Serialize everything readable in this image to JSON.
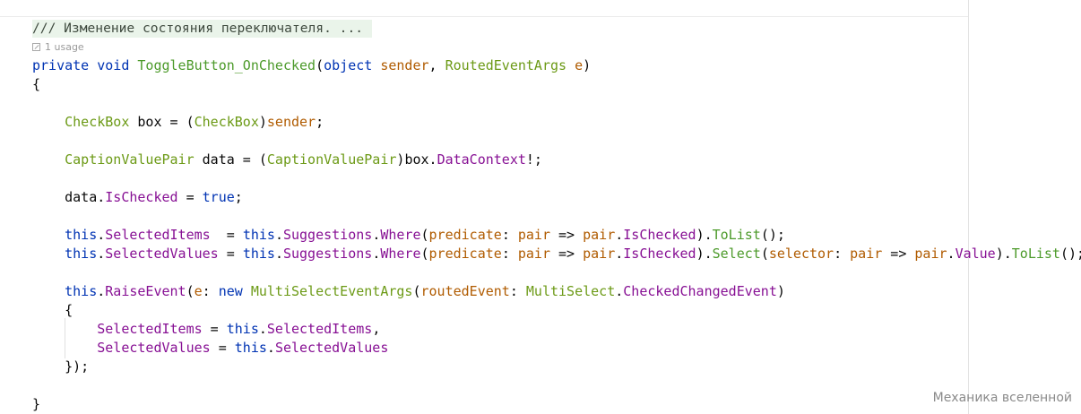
{
  "doc_comment": "/// Изменение состояния переключателя. ...",
  "usage_hint": "1 usage",
  "code": {
    "l1": {
      "kw_private": "private",
      "kw_void": "void",
      "method": "ToggleButton_OnChecked",
      "paren_open": "(",
      "kw_object": "object",
      "p_sender": "sender",
      "comma": ", ",
      "t_args": "RoutedEventArgs",
      "p_e": "e",
      "paren_close": ")"
    },
    "l2": {
      "brace": "{"
    },
    "l3": {
      "t_checkbox": "CheckBox",
      "v_box": "box",
      "eq": " = (",
      "t_checkbox2": "CheckBox",
      "close": ")",
      "p_sender": "sender",
      "semi": ";"
    },
    "l4": {
      "t_pair": "CaptionValuePair",
      "v_data": "data",
      "eq": " = (",
      "t_pair2": "CaptionValuePair",
      "close": ")",
      "v_box": "box",
      "dot": ".",
      "prop": "DataContext",
      "tail": "!;"
    },
    "l5": {
      "v_data": "data",
      "dot": ".",
      "prop": "IsChecked",
      "eq": " = ",
      "kw_true": "true",
      "semi": ";"
    },
    "l6": {
      "kw_this": "this",
      "dot1": ".",
      "prop1": "SelectedItems",
      "eq": "  = ",
      "kw_this2": "this",
      "dot2": ".",
      "prop2": "Suggestions",
      "dot3": ".",
      "fn_where": "Where",
      "open": "(",
      "pname": "predicate",
      "colon": ": ",
      "lam": "pair",
      "arrow": " => ",
      "lam2": "pair",
      "dot4": ".",
      "prop3": "IsChecked",
      "close": ").",
      "fn_tolist": "ToList",
      "tail": "();"
    },
    "l7": {
      "kw_this": "this",
      "dot1": ".",
      "prop1": "SelectedValues",
      "eq": " = ",
      "kw_this2": "this",
      "dot2": ".",
      "prop2": "Suggestions",
      "dot3": ".",
      "fn_where": "Where",
      "open": "(",
      "pname": "predicate",
      "colon": ": ",
      "lam": "pair",
      "arrow": " => ",
      "lam2": "pair",
      "dot4": ".",
      "prop3": "IsChecked",
      "close": ").",
      "fn_select": "Select",
      "open2": "(",
      "pname2": "selector",
      "colon2": ": ",
      "lam3": "pair",
      "arrow2": " => ",
      "lam4": "pair",
      "dot5": ".",
      "prop4": "Value",
      "close2": ").",
      "fn_tolist": "ToList",
      "tail": "();"
    },
    "l8": {
      "kw_this": "this",
      "dot1": ".",
      "fn_raise": "RaiseEvent",
      "open": "(",
      "pname": "e",
      "colon": ": ",
      "kw_new": "new",
      "t_msargs": "MultiSelectEventArgs",
      "open2": "(",
      "pname2": "routedEvent",
      "colon2": ": ",
      "t_ms": "MultiSelect",
      "dot2": ".",
      "prop": "CheckedChangedEvent",
      "close": ")"
    },
    "l9": {
      "brace": "{"
    },
    "l10": {
      "prop1": "SelectedItems",
      "eq": " = ",
      "kw_this": "this",
      "dot": ".",
      "prop2": "SelectedItems",
      "comma": ","
    },
    "l11": {
      "prop1": "SelectedValues",
      "eq": " = ",
      "kw_this": "this",
      "dot": ".",
      "prop2": "SelectedValues"
    },
    "l12": {
      "close": "});"
    },
    "l13": {
      "brace": "}"
    }
  },
  "watermark": "Механика вселенной"
}
